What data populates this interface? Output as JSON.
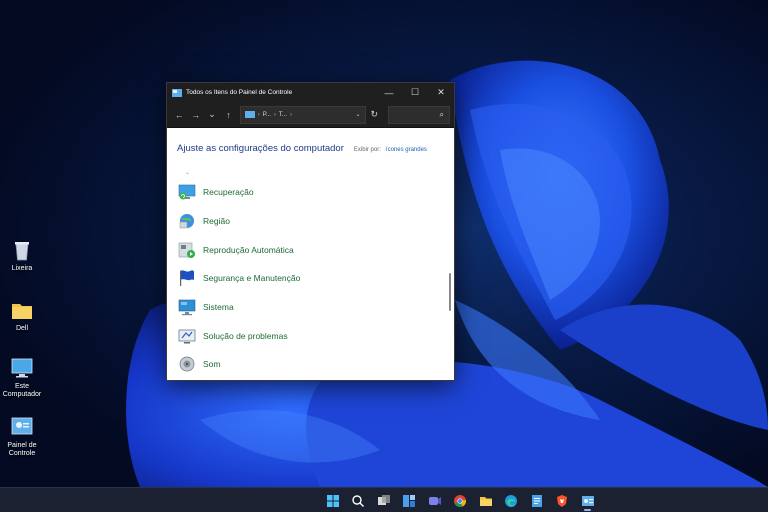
{
  "desktop": {
    "icons": [
      {
        "label": "Lixeira",
        "icon": "recycle-bin-icon"
      },
      {
        "label": "Dell",
        "icon": "folder-icon"
      },
      {
        "label": "Este Computador",
        "icon": "computer-icon"
      },
      {
        "label": "Painel de Controle",
        "icon": "control-panel-icon"
      }
    ]
  },
  "window": {
    "title": "Todos os Itens do Painel de Controle",
    "buttons": {
      "minimize": "—",
      "maximize": "☐",
      "close": "✕"
    },
    "nav": {
      "back": "←",
      "forward": "→",
      "recent": "⌄",
      "up": "↑",
      "refresh": "↻",
      "search_glyph": "⌕"
    },
    "address": {
      "crumbs": [
        "P...",
        "T..."
      ],
      "separator": "›",
      "dropdown": "⌄"
    },
    "heading": "Ajuste as configurações do computador",
    "view_by_label": "Exibir por:",
    "view_by_value": "ícones grandes",
    "collapse_glyph": "⌄",
    "items": [
      {
        "label": "Recuperação",
        "icon": "recovery-icon"
      },
      {
        "label": "Região",
        "icon": "region-icon"
      },
      {
        "label": "Reprodução Automática",
        "icon": "autoplay-icon"
      },
      {
        "label": "Segurança e Manutenção",
        "icon": "security-flag-icon"
      },
      {
        "label": "Sistema",
        "icon": "system-icon"
      },
      {
        "label": "Solução de problemas",
        "icon": "troubleshooting-icon"
      },
      {
        "label": "Som",
        "icon": "sound-icon"
      }
    ]
  },
  "taskbar": {
    "icons": [
      "start-icon",
      "search-icon",
      "task-view-icon",
      "widgets-icon",
      "chat-icon",
      "chrome-icon",
      "file-explorer-icon",
      "edge-icon",
      "notepad-icon",
      "brave-icon",
      "control-panel-icon"
    ],
    "active": "control-panel-icon"
  },
  "colors": {
    "accent": "#1e3a8a",
    "item_link": "#1d6b35",
    "taskbar": "#1b2130"
  }
}
